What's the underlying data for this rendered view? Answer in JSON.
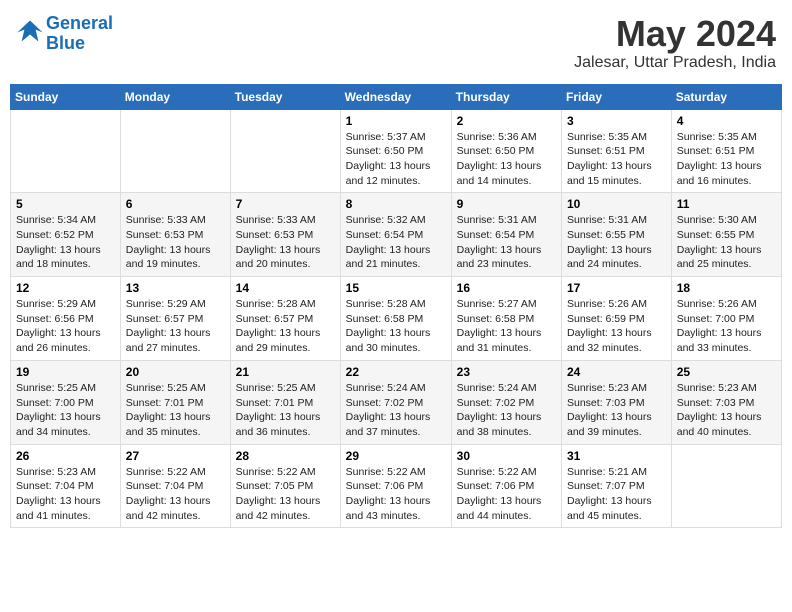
{
  "logo": {
    "line1": "General",
    "line2": "Blue"
  },
  "title": "May 2024",
  "location": "Jalesar, Uttar Pradesh, India",
  "days_of_week": [
    "Sunday",
    "Monday",
    "Tuesday",
    "Wednesday",
    "Thursday",
    "Friday",
    "Saturday"
  ],
  "weeks": [
    [
      {
        "day": "",
        "info": ""
      },
      {
        "day": "",
        "info": ""
      },
      {
        "day": "",
        "info": ""
      },
      {
        "day": "1",
        "info": "Sunrise: 5:37 AM\nSunset: 6:50 PM\nDaylight: 13 hours and 12 minutes."
      },
      {
        "day": "2",
        "info": "Sunrise: 5:36 AM\nSunset: 6:50 PM\nDaylight: 13 hours and 14 minutes."
      },
      {
        "day": "3",
        "info": "Sunrise: 5:35 AM\nSunset: 6:51 PM\nDaylight: 13 hours and 15 minutes."
      },
      {
        "day": "4",
        "info": "Sunrise: 5:35 AM\nSunset: 6:51 PM\nDaylight: 13 hours and 16 minutes."
      }
    ],
    [
      {
        "day": "5",
        "info": "Sunrise: 5:34 AM\nSunset: 6:52 PM\nDaylight: 13 hours and 18 minutes."
      },
      {
        "day": "6",
        "info": "Sunrise: 5:33 AM\nSunset: 6:53 PM\nDaylight: 13 hours and 19 minutes."
      },
      {
        "day": "7",
        "info": "Sunrise: 5:33 AM\nSunset: 6:53 PM\nDaylight: 13 hours and 20 minutes."
      },
      {
        "day": "8",
        "info": "Sunrise: 5:32 AM\nSunset: 6:54 PM\nDaylight: 13 hours and 21 minutes."
      },
      {
        "day": "9",
        "info": "Sunrise: 5:31 AM\nSunset: 6:54 PM\nDaylight: 13 hours and 23 minutes."
      },
      {
        "day": "10",
        "info": "Sunrise: 5:31 AM\nSunset: 6:55 PM\nDaylight: 13 hours and 24 minutes."
      },
      {
        "day": "11",
        "info": "Sunrise: 5:30 AM\nSunset: 6:55 PM\nDaylight: 13 hours and 25 minutes."
      }
    ],
    [
      {
        "day": "12",
        "info": "Sunrise: 5:29 AM\nSunset: 6:56 PM\nDaylight: 13 hours and 26 minutes."
      },
      {
        "day": "13",
        "info": "Sunrise: 5:29 AM\nSunset: 6:57 PM\nDaylight: 13 hours and 27 minutes."
      },
      {
        "day": "14",
        "info": "Sunrise: 5:28 AM\nSunset: 6:57 PM\nDaylight: 13 hours and 29 minutes."
      },
      {
        "day": "15",
        "info": "Sunrise: 5:28 AM\nSunset: 6:58 PM\nDaylight: 13 hours and 30 minutes."
      },
      {
        "day": "16",
        "info": "Sunrise: 5:27 AM\nSunset: 6:58 PM\nDaylight: 13 hours and 31 minutes."
      },
      {
        "day": "17",
        "info": "Sunrise: 5:26 AM\nSunset: 6:59 PM\nDaylight: 13 hours and 32 minutes."
      },
      {
        "day": "18",
        "info": "Sunrise: 5:26 AM\nSunset: 7:00 PM\nDaylight: 13 hours and 33 minutes."
      }
    ],
    [
      {
        "day": "19",
        "info": "Sunrise: 5:25 AM\nSunset: 7:00 PM\nDaylight: 13 hours and 34 minutes."
      },
      {
        "day": "20",
        "info": "Sunrise: 5:25 AM\nSunset: 7:01 PM\nDaylight: 13 hours and 35 minutes."
      },
      {
        "day": "21",
        "info": "Sunrise: 5:25 AM\nSunset: 7:01 PM\nDaylight: 13 hours and 36 minutes."
      },
      {
        "day": "22",
        "info": "Sunrise: 5:24 AM\nSunset: 7:02 PM\nDaylight: 13 hours and 37 minutes."
      },
      {
        "day": "23",
        "info": "Sunrise: 5:24 AM\nSunset: 7:02 PM\nDaylight: 13 hours and 38 minutes."
      },
      {
        "day": "24",
        "info": "Sunrise: 5:23 AM\nSunset: 7:03 PM\nDaylight: 13 hours and 39 minutes."
      },
      {
        "day": "25",
        "info": "Sunrise: 5:23 AM\nSunset: 7:03 PM\nDaylight: 13 hours and 40 minutes."
      }
    ],
    [
      {
        "day": "26",
        "info": "Sunrise: 5:23 AM\nSunset: 7:04 PM\nDaylight: 13 hours and 41 minutes."
      },
      {
        "day": "27",
        "info": "Sunrise: 5:22 AM\nSunset: 7:04 PM\nDaylight: 13 hours and 42 minutes."
      },
      {
        "day": "28",
        "info": "Sunrise: 5:22 AM\nSunset: 7:05 PM\nDaylight: 13 hours and 42 minutes."
      },
      {
        "day": "29",
        "info": "Sunrise: 5:22 AM\nSunset: 7:06 PM\nDaylight: 13 hours and 43 minutes."
      },
      {
        "day": "30",
        "info": "Sunrise: 5:22 AM\nSunset: 7:06 PM\nDaylight: 13 hours and 44 minutes."
      },
      {
        "day": "31",
        "info": "Sunrise: 5:21 AM\nSunset: 7:07 PM\nDaylight: 13 hours and 45 minutes."
      },
      {
        "day": "",
        "info": ""
      }
    ]
  ]
}
